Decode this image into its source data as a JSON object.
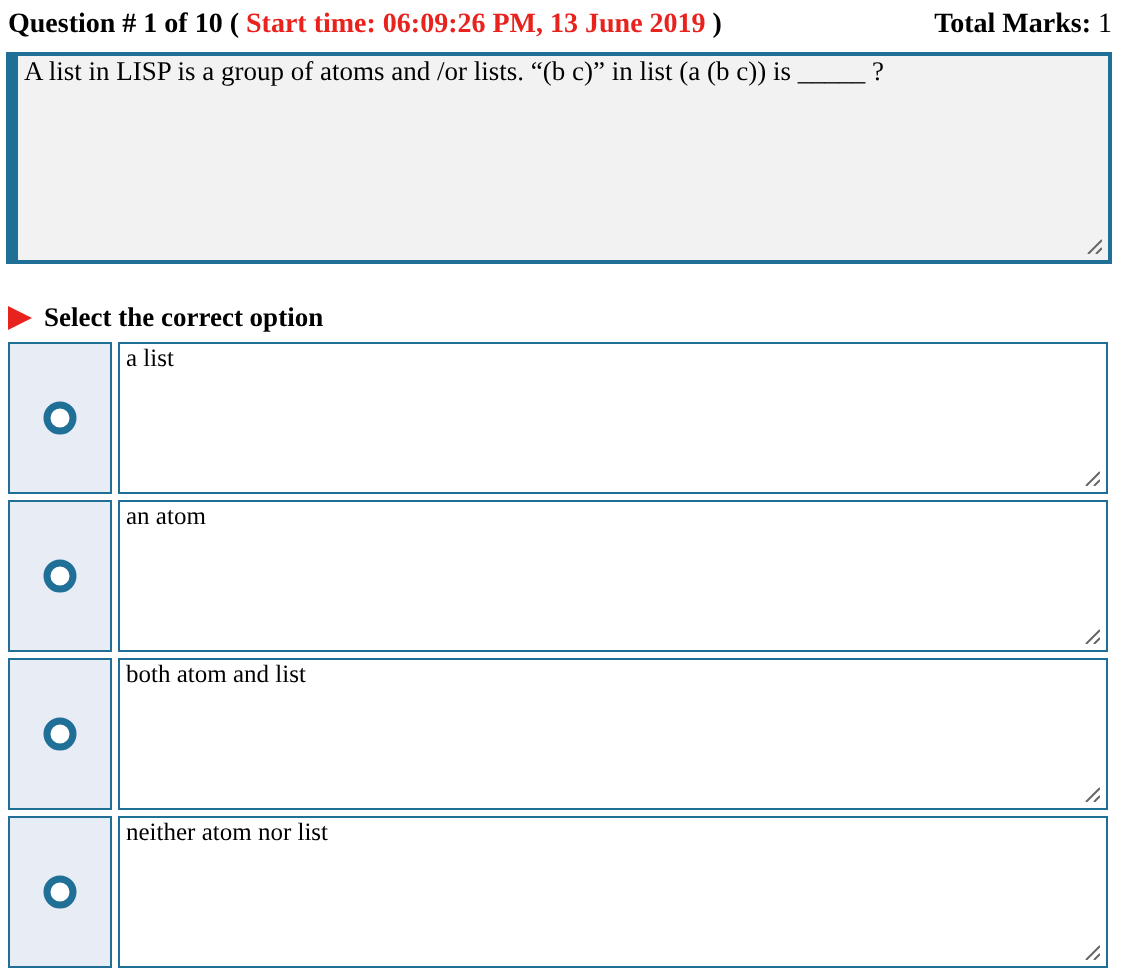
{
  "header": {
    "question_label": "Question # 1 of 10 (",
    "start_time": "Start time: 06:09:26 PM, 13 June 2019",
    "close_paren": ")",
    "total_marks_label": "Total Marks:",
    "total_marks": "1"
  },
  "question": {
    "text": "A list in LISP is a group of atoms and /or lists. “(b c)” in list (a (b c))  is  _____ ?"
  },
  "instruction": "Select the correct option",
  "options": [
    {
      "text": "a list",
      "selected": false
    },
    {
      "text": "an atom",
      "selected": false
    },
    {
      "text": "both atom and list",
      "selected": false
    },
    {
      "text": "neither atom nor list",
      "selected": false
    }
  ]
}
